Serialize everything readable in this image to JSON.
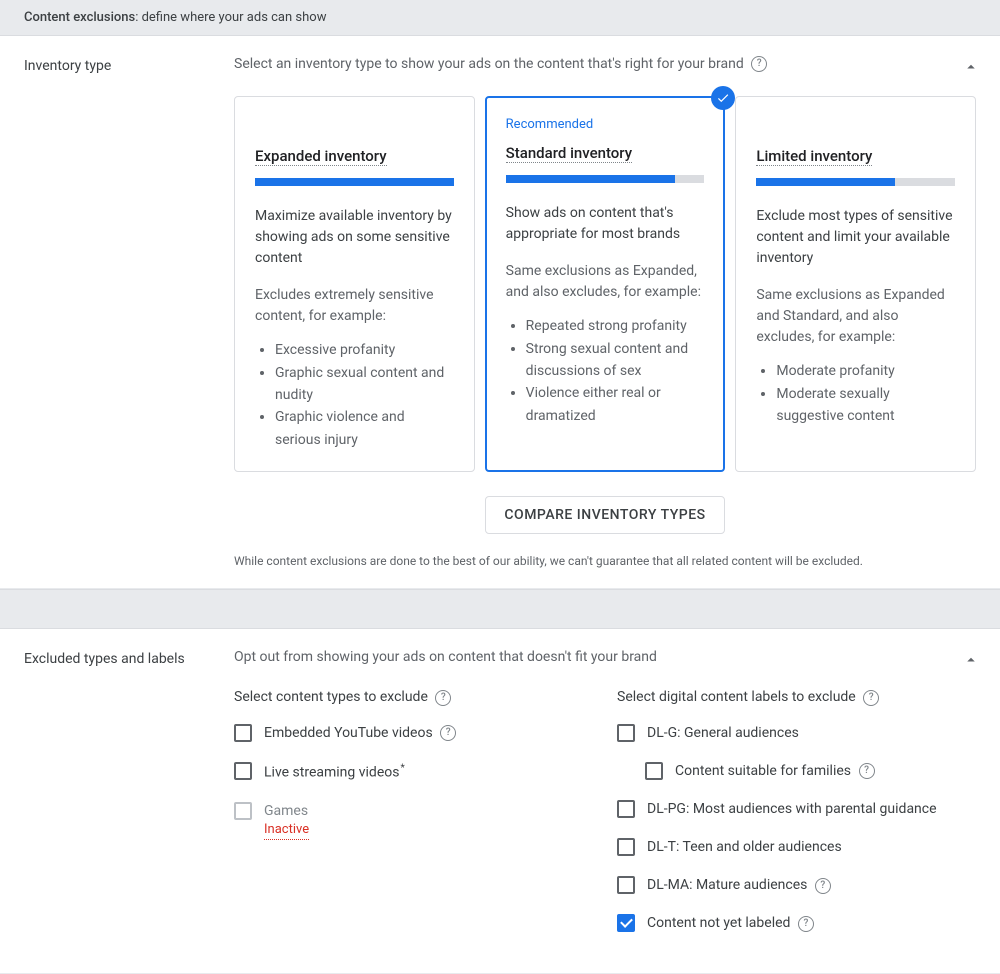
{
  "header": {
    "title": "Content exclusions",
    "subtitle": ": define where your ads can show"
  },
  "inventory": {
    "label": "Inventory type",
    "description": "Select an inventory type to show your ads on the content that's right for your brand",
    "compare_button": "COMPARE INVENTORY TYPES",
    "disclaimer": "While content exclusions are done to the best of our ability, we can't guarantee that all related content will be excluded.",
    "recommended_tag": "Recommended",
    "cards": [
      {
        "title": "Expanded inventory",
        "fill": "100",
        "summary": "Maximize available inventory by showing ads on some sensitive content",
        "excludes_intro": "Excludes extremely sensitive content, for example:",
        "bullets": [
          "Excessive profanity",
          "Graphic sexual content and nudity",
          "Graphic violence and serious injury"
        ]
      },
      {
        "title": "Standard inventory",
        "fill": "85",
        "summary": "Show ads on content that's appropriate for most brands",
        "excludes_intro": "Same exclusions as Expanded, and also excludes, for example:",
        "bullets": [
          "Repeated strong profanity",
          "Strong sexual content and discussions of sex",
          "Violence either real or dramatized"
        ]
      },
      {
        "title": "Limited inventory",
        "fill": "70",
        "summary": "Exclude most types of sensitive content and limit your available inventory",
        "excludes_intro": "Same exclusions as Expanded and Standard, and also excludes, for example:",
        "bullets": [
          "Moderate profanity",
          "Moderate sexually suggestive content"
        ]
      }
    ]
  },
  "excluded": {
    "label": "Excluded types and labels",
    "description": "Opt out from showing your ads on content that doesn't fit your brand",
    "types_heading": "Select content types to exclude",
    "labels_heading": "Select digital content labels to exclude",
    "types": [
      {
        "label": "Embedded YouTube videos",
        "help": true
      },
      {
        "label": "Live streaming videos",
        "asterisk": true
      },
      {
        "label": "Games",
        "disabled": true,
        "inactive": "Inactive"
      }
    ],
    "labels": [
      {
        "label": "DL-G: General audiences"
      },
      {
        "label": "Content suitable for families",
        "indent": true,
        "help": true
      },
      {
        "label": "DL-PG: Most audiences with parental guidance"
      },
      {
        "label": "DL-T: Teen and older audiences"
      },
      {
        "label": "DL-MA: Mature audiences",
        "help": true
      },
      {
        "label": "Content not yet labeled",
        "checked": true,
        "help": true
      }
    ]
  }
}
